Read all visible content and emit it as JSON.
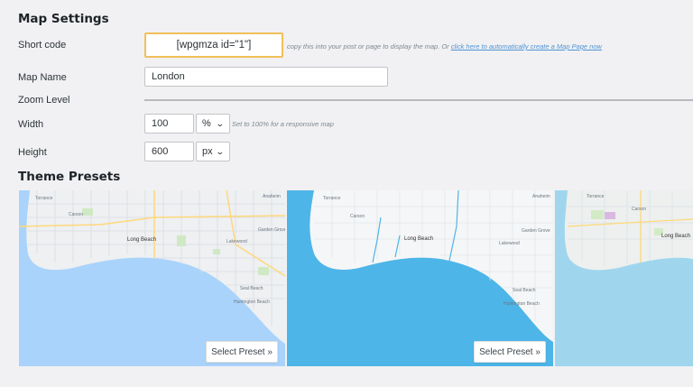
{
  "map_settings": {
    "title": "Map Settings",
    "shortcode": {
      "label": "Short code",
      "value": "[wpgmza id=\"1\"]",
      "hint_before": "copy this into your post or page to display the map. Or ",
      "hint_link": "click here to automatically create a Map Page now"
    },
    "map_name": {
      "label": "Map Name",
      "value": "London"
    },
    "zoom_level": {
      "label": "Zoom Level"
    },
    "width": {
      "label": "Width",
      "value": "100",
      "unit": "%",
      "hint": "Set to 100% for a responsive map"
    },
    "height": {
      "label": "Height",
      "value": "600",
      "unit": "px"
    }
  },
  "theme_presets": {
    "title": "Theme Presets",
    "presets": [
      {
        "style": "default",
        "button_label": "Select Preset »",
        "land": "#eef0f2",
        "water": "#a9d3fb",
        "park": "#cfe9c4",
        "roads": "#d7dce3"
      },
      {
        "style": "blue-water",
        "button_label": "Select Preset »",
        "land": "#f5f6f7",
        "water": "#4db5e8",
        "park": "#eef0f2",
        "roads": "#e2e6ea"
      },
      {
        "style": "light-blue",
        "button_label": "",
        "land": "#edf0ee",
        "water": "#9fd6ee",
        "park": "#d3eac7",
        "roads": "#dde2e6"
      }
    ],
    "place_labels": [
      "Torrance",
      "Carson",
      "Long Beach",
      "Lakewood",
      "Seal Beach",
      "Huntington Beach",
      "Garden Grove",
      "Anaheim"
    ]
  },
  "colors": {
    "shortcode_border": "#f0c05a",
    "link": "#4f94d4",
    "page_background": "#f1f1f3"
  }
}
